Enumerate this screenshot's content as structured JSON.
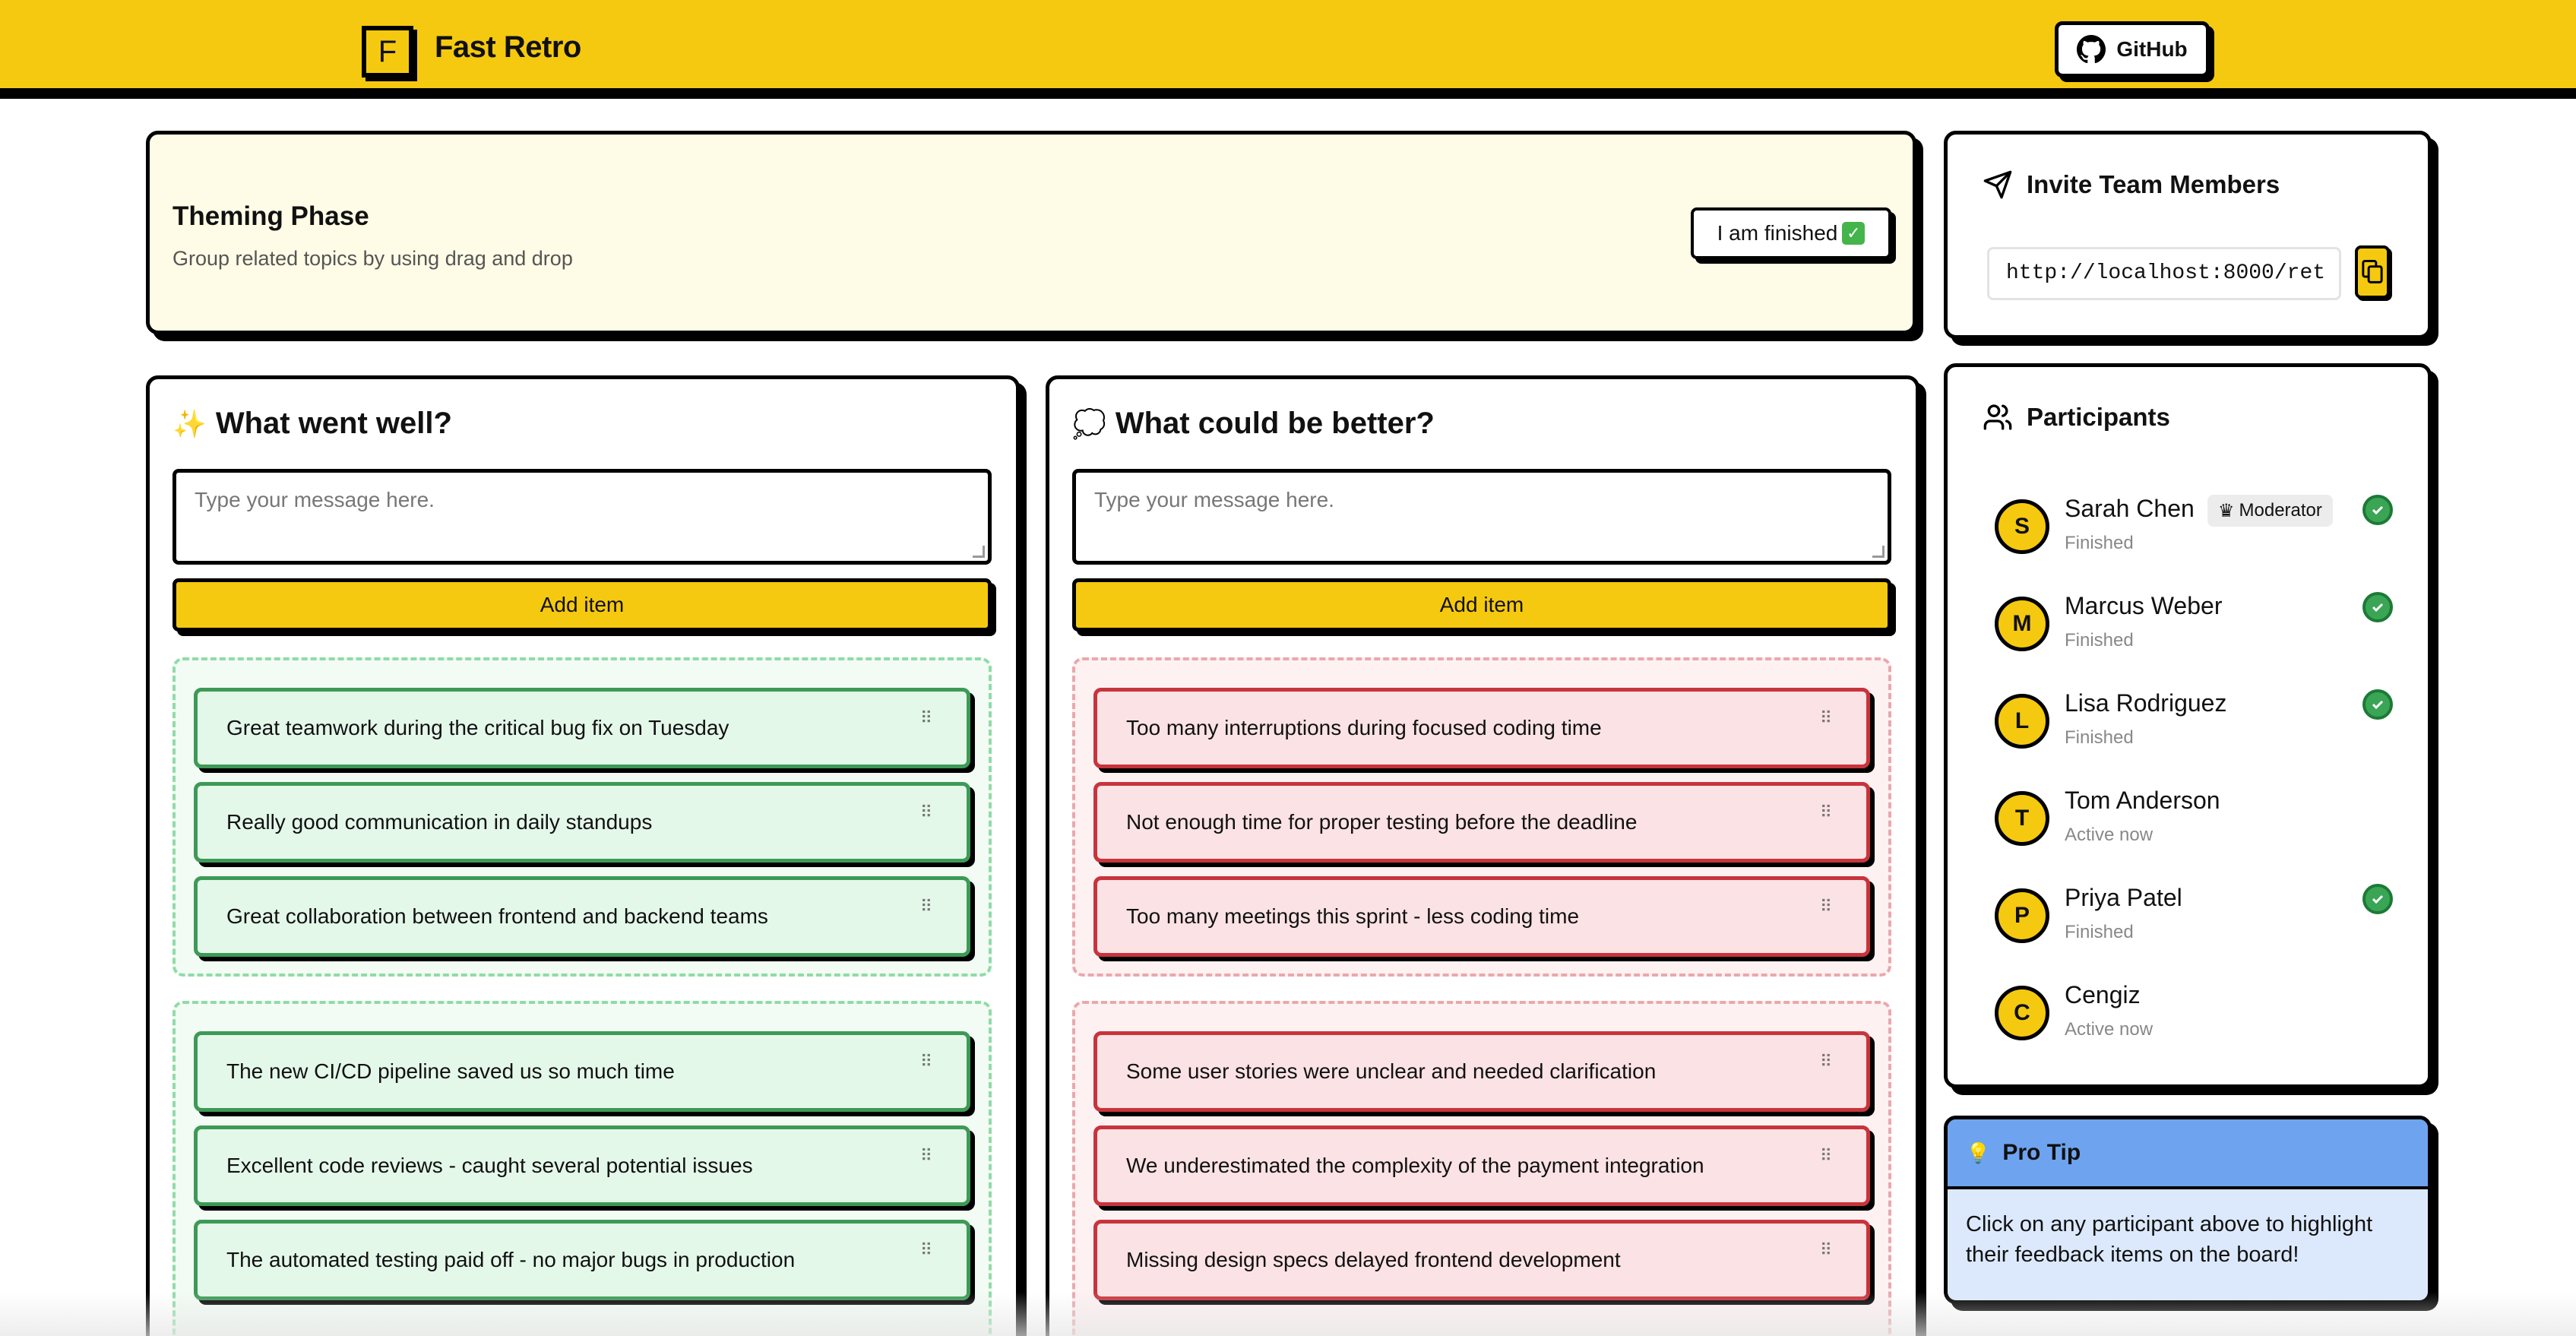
{
  "header": {
    "logo_letter": "F",
    "app_name": "Fast Retro",
    "github_label": "GitHub"
  },
  "phase": {
    "title": "Theming Phase",
    "subtitle": "Group related topics by using drag and drop",
    "finished_label": "I am finished",
    "finished_emoji": "✓"
  },
  "columns": {
    "well": {
      "emoji": "✨",
      "title": "What went well?",
      "placeholder": "Type your message here.",
      "add_label": "Add item",
      "groups": [
        [
          "Great teamwork during the critical bug fix on Tuesday",
          "Really good communication in daily standups",
          "Great collaboration between frontend and backend teams"
        ],
        [
          "The new CI/CD pipeline saved us so much time",
          "Excellent code reviews - caught several potential issues",
          "The automated testing paid off - no major bugs in production"
        ]
      ]
    },
    "better": {
      "emoji": "💭",
      "title": "What could be better?",
      "placeholder": "Type your message here.",
      "add_label": "Add item",
      "groups": [
        [
          "Too many interruptions during focused coding time",
          "Not enough time for proper testing before the deadline",
          "Too many meetings this sprint - less coding time"
        ],
        [
          "Some user stories were unclear and needed clarification",
          "We underestimated the complexity of the payment integration",
          "Missing design specs delayed frontend development"
        ]
      ]
    }
  },
  "invite": {
    "title": "Invite Team Members",
    "url": "http://localhost:8000/ret"
  },
  "participants": {
    "title": "Participants",
    "moderator_label": "Moderator",
    "list": [
      {
        "initial": "S",
        "name": "Sarah Chen",
        "status": "Finished"
      },
      {
        "initial": "M",
        "name": "Marcus Weber",
        "status": "Finished"
      },
      {
        "initial": "L",
        "name": "Lisa Rodriguez",
        "status": "Finished"
      },
      {
        "initial": "T",
        "name": "Tom Anderson",
        "status": "Active now"
      },
      {
        "initial": "P",
        "name": "Priya Patel",
        "status": "Finished"
      },
      {
        "initial": "C",
        "name": "Cengiz",
        "status": "Active now"
      }
    ]
  },
  "protip": {
    "title": "Pro Tip",
    "body": "Click on any participant above to highlight their feedback items on the board!"
  },
  "colors": {
    "brand_yellow": "#f5c90f",
    "good_bg": "#e4f8ea",
    "good_border": "#3d9a56",
    "bad_bg": "#fbe2e4",
    "bad_border": "#c8343c",
    "tip_header": "#6ea3ef",
    "tip_bg": "#dce9fc"
  }
}
